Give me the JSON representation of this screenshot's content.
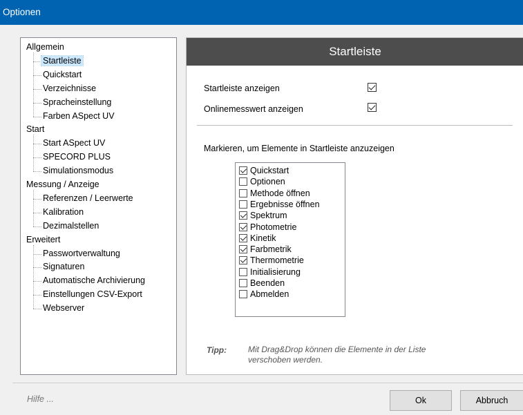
{
  "window": {
    "title": "Optionen"
  },
  "tree": {
    "categories": [
      {
        "label": "Allgemein",
        "children": [
          "Startleiste",
          "Quickstart",
          "Verzeichnisse",
          "Spracheinstellung",
          "Farben ASpect UV"
        ]
      },
      {
        "label": "Start",
        "children": [
          "Start ASpect UV",
          "SPECORD PLUS",
          "Simulationsmodus"
        ]
      },
      {
        "label": "Messung / Anzeige",
        "children": [
          "Referenzen / Leerwerte",
          "Kalibration",
          "Dezimalstellen"
        ]
      },
      {
        "label": "Erweitert",
        "children": [
          "Passwortverwaltung",
          "Signaturen",
          "Automatische Archivierung",
          "Einstellungen CSV-Export",
          "Webserver"
        ]
      }
    ],
    "selected": "Startleiste"
  },
  "panel": {
    "header": "Startleiste",
    "options": [
      {
        "label": "Startleiste anzeigen",
        "checked": true
      },
      {
        "label": "Onlinemesswert anzeigen",
        "checked": true
      }
    ],
    "list_label": "Markieren, um Elemente in Startleiste anzuzeigen",
    "list_items": [
      {
        "label": "Quickstart",
        "checked": true
      },
      {
        "label": "Optionen",
        "checked": false
      },
      {
        "label": "Methode öffnen",
        "checked": false
      },
      {
        "label": "Ergebnisse öffnen",
        "checked": false
      },
      {
        "label": "Spektrum",
        "checked": true
      },
      {
        "label": "Photometrie",
        "checked": true
      },
      {
        "label": "Kinetik",
        "checked": true
      },
      {
        "label": "Farbmetrik",
        "checked": true
      },
      {
        "label": "Thermometrie",
        "checked": true
      },
      {
        "label": "Initialisierung",
        "checked": false
      },
      {
        "label": "Beenden",
        "checked": false
      },
      {
        "label": "Abmelden",
        "checked": false
      }
    ],
    "tip_label": "Tipp:",
    "tip_text": "Mit Drag&Drop können die Elemente in der Liste verschoben werden."
  },
  "footer": {
    "help": "Hilfe ...",
    "ok": "Ok",
    "cancel": "Abbruch"
  }
}
